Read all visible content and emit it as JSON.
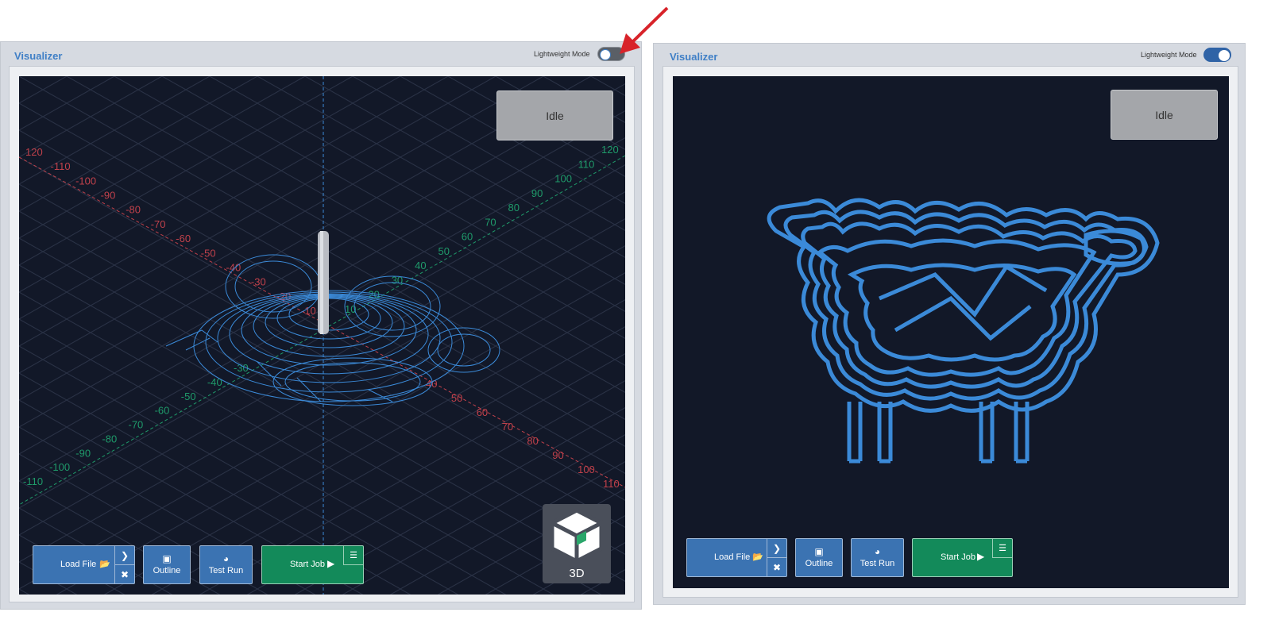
{
  "left_panel": {
    "title": "Visualizer",
    "lightweight_label": "Lightweight Mode",
    "lightweight_on": false,
    "status": "Idle",
    "view_cube_label": "3D",
    "buttons": {
      "load_file": "Load File",
      "outline": "Outline",
      "test_run": "Test Run",
      "start_job": "Start Job"
    },
    "axis_labels_red": [
      "120",
      "-110",
      "-100",
      "-90",
      "-80",
      "-70",
      "-60",
      "-50",
      "-40",
      "-30",
      "-20",
      "-10",
      "40",
      "50",
      "60",
      "70",
      "80",
      "90",
      "100",
      "110"
    ],
    "axis_labels_green": [
      "120",
      "110",
      "100",
      "90",
      "80",
      "70",
      "60",
      "50",
      "40",
      "30",
      "20",
      "10",
      "-30",
      "-40",
      "-50",
      "-60",
      "-70",
      "-80",
      "-90",
      "-100",
      "-110"
    ]
  },
  "right_panel": {
    "title": "Visualizer",
    "lightweight_label": "Lightweight Mode",
    "lightweight_on": true,
    "status": "Idle",
    "buttons": {
      "load_file": "Load File",
      "outline": "Outline",
      "test_run": "Test Run",
      "start_job": "Start Job"
    }
  },
  "annotation": {
    "arrow_color": "#d8232a"
  },
  "colors": {
    "accent_blue": "#3f7fc6",
    "toolpath": "#3b8ad8",
    "canvas_bg": "#121828",
    "start_green": "#138a5a",
    "toggle_on": "#2f63a6",
    "toggle_off": "#5a5f66"
  }
}
